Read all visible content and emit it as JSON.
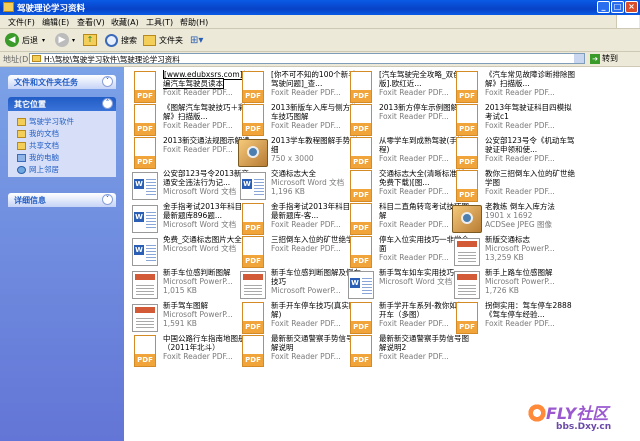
{
  "window": {
    "title": "驾驶理论学习资料"
  },
  "title_buttons": {
    "min": "_",
    "max": "□",
    "close": "×"
  },
  "menu": [
    "文件(F)",
    "编辑(E)",
    "查看(V)",
    "收藏(A)",
    "工具(T)",
    "帮助(H)"
  ],
  "toolbar": {
    "back": "后退",
    "forward": "",
    "up": "",
    "search": "搜索",
    "folders": "文件夹",
    "views": "⊞▾"
  },
  "address": {
    "label": "地址(D)",
    "path": "H:\\驾校\\驾驶学习软件\\驾驶理论学习资料",
    "go": "转到"
  },
  "sidebar": {
    "tasks_title": "文件和文件夹任务",
    "places_title": "其它位置",
    "places": [
      "驾驶学习软件",
      "我的文档",
      "共享文档",
      "我的电脑",
      "网上邻居"
    ],
    "details_title": "详细信息"
  },
  "files": [
    {
      "name": "[www.edubxsrs.com]新编汽车驾驶员读本",
      "type": "Foxit Reader PDF...",
      "size": "",
      "icon": "pdf"
    },
    {
      "name": "[你不可不知的100个新手驾驶问题]_查...",
      "type": "Foxit Reader PDF...",
      "size": "",
      "icon": "pdf"
    },
    {
      "name": "[汽车驾驶完全攻略_双色版].欧红近...",
      "type": "Foxit Reader PDF...",
      "size": "",
      "icon": "pdf"
    },
    {
      "name": "《汽车常见故障诊断排除图解》扫描版...",
      "type": "Foxit Reader PDF...",
      "size": "",
      "icon": "pdf"
    },
    {
      "name": "《图解汽车驾驶技巧＋彩图解》扫描版...",
      "type": "Foxit Reader PDF...",
      "size": "",
      "icon": "pdf"
    },
    {
      "name": "2013新版车入库与侧方停车技巧图解",
      "type": "Foxit Reader PDF...",
      "size": "",
      "icon": "pdf"
    },
    {
      "name": "2013新方停车示例图解",
      "type": "Foxit Reader PDF...",
      "size": "",
      "icon": "pdf"
    },
    {
      "name": "2013年驾驶证科目四模拟考试c1",
      "type": "Foxit Reader PDF...",
      "size": "",
      "icon": "pdf"
    },
    {
      "name": "2013新交通法规图示解读",
      "type": "Foxit Reader PDF...",
      "size": "",
      "icon": "pdf"
    },
    {
      "name": "2013学车教程图解手势详细",
      "type": "750 x 3000",
      "size": "",
      "icon": "img"
    },
    {
      "name": "从零学车到成熟驾驶(手教程)",
      "type": "Foxit Reader PDF...",
      "size": "",
      "icon": "pdf"
    },
    {
      "name": "公安部123号令《机动车驾驶证申领和使...",
      "type": "Foxit Reader PDF...",
      "size": "",
      "icon": "pdf"
    },
    {
      "name": "公安部123号令2013新交通安全违法行为记...",
      "type": "Microsoft Word 文档",
      "size": "",
      "icon": "doc"
    },
    {
      "name": "交通标志大全",
      "type": "Microsoft Word 文档",
      "size": "1,196 KB",
      "icon": "doc"
    },
    {
      "name": "交通标志大全(清晰标准版免费下载)[图...",
      "type": "Foxit Reader PDF...",
      "size": "",
      "icon": "pdf"
    },
    {
      "name": "教你三招倒车入位的矿世绝学图",
      "type": "Foxit Reader PDF...",
      "size": "",
      "icon": "pdf"
    },
    {
      "name": "金手指考试2013年科目一最新题库896题...",
      "type": "Microsoft Word 文档",
      "size": "",
      "icon": "doc"
    },
    {
      "name": "金手指考试2013年科目一最新题库-客...",
      "type": "Foxit Reader PDF...",
      "size": "",
      "icon": "pdf"
    },
    {
      "name": "科目二直角转弯考试技巧图解",
      "type": "Foxit Reader PDF...",
      "size": "",
      "icon": "pdf"
    },
    {
      "name": "老教练 倒车入库方法",
      "type": "1901 x 1692",
      "size": "ACDSee JPEG 图像",
      "icon": "img"
    },
    {
      "name": "免费_交通标志图片大全",
      "type": "Microsoft Word 文档",
      "size": "",
      "icon": "doc"
    },
    {
      "name": "三招倒车入位的矿世绝学",
      "type": "Foxit Reader PDF...",
      "size": "",
      "icon": "pdf"
    },
    {
      "name": "停车入位实用技巧一非常全面",
      "type": "Foxit Reader PDF...",
      "size": "",
      "icon": "pdf"
    },
    {
      "name": "新版交通标志",
      "type": "Microsoft PowerP...",
      "size": "13,259 KB",
      "icon": "ppt"
    },
    {
      "name": "新手车位感判断图解",
      "type": "Microsoft PowerP...",
      "size": "1,015 KB",
      "icon": "ppt"
    },
    {
      "name": "新手车位感判断图解及倒车技巧",
      "type": "Microsoft PowerP...",
      "size": "",
      "icon": "ppt"
    },
    {
      "name": "新手驾车如车实用技巧",
      "type": "Microsoft Word 文档",
      "size": "",
      "icon": "doc"
    },
    {
      "name": "新手上路车位感图解",
      "type": "Microsoft PowerP...",
      "size": "1,726 KB",
      "icon": "ppt"
    },
    {
      "name": "新手驾车图解",
      "type": "Microsoft PowerP...",
      "size": "1,591 KB",
      "icon": "ppt"
    },
    {
      "name": "新手开车停车技巧(真实图解)",
      "type": "Foxit Reader PDF...",
      "size": "",
      "icon": "pdf"
    },
    {
      "name": "新手学开车系列-教你如何开车（多图）",
      "type": "Foxit Reader PDF...",
      "size": "",
      "icon": "pdf"
    },
    {
      "name": "拐倒实用：驾车停车2888《驾车停车经验...",
      "type": "Foxit Reader PDF...",
      "size": "",
      "icon": "pdf"
    },
    {
      "name": "中国公路行车指南地图册（2011年北斗）",
      "type": "Foxit Reader PDF...",
      "size": "",
      "icon": "pdf"
    },
    {
      "name": "最新新交通警察手势信号图解说明",
      "type": "Foxit Reader PDF...",
      "size": "",
      "icon": "pdf"
    },
    {
      "name": "最新新交通警察手势信号图解说明2",
      "type": "Foxit Reader PDF...",
      "size": "",
      "icon": "pdf"
    }
  ],
  "watermark": {
    "brand": "FLY社区",
    "url": "bbs.Dxy.cn"
  }
}
